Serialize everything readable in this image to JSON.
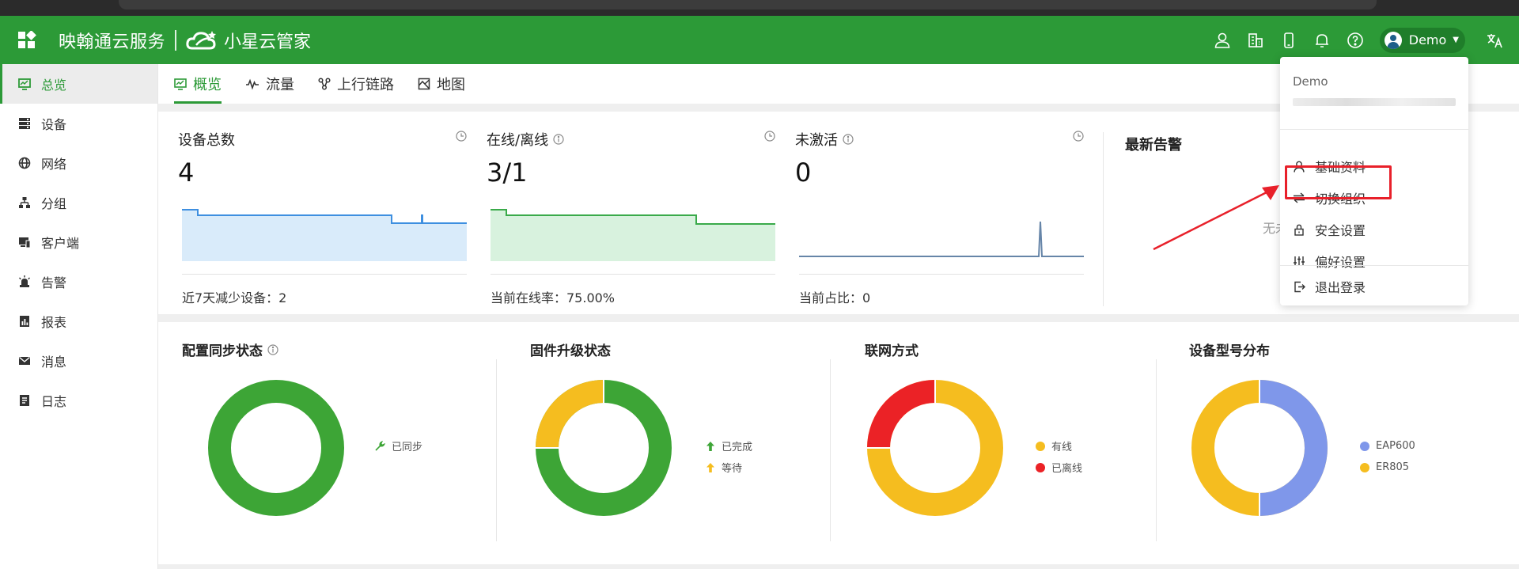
{
  "header": {
    "brand": "映翰通云服务",
    "product": "小星云管家",
    "user_name": "Demo"
  },
  "sidebar": {
    "items": [
      {
        "label": "总览",
        "icon": "monitor-icon",
        "active": true
      },
      {
        "label": "设备",
        "icon": "server-icon",
        "active": false
      },
      {
        "label": "网络",
        "icon": "globe-icon",
        "active": false
      },
      {
        "label": "分组",
        "icon": "sitemap-icon",
        "active": false
      },
      {
        "label": "客户端",
        "icon": "devices-icon",
        "active": false
      },
      {
        "label": "告警",
        "icon": "alarm-light-icon",
        "active": false
      },
      {
        "label": "报表",
        "icon": "report-icon",
        "active": false
      },
      {
        "label": "消息",
        "icon": "envelope-icon",
        "active": false
      },
      {
        "label": "日志",
        "icon": "logbook-icon",
        "active": false
      }
    ]
  },
  "tabs": [
    {
      "label": "概览",
      "icon": "monitor-icon",
      "active": true
    },
    {
      "label": "流量",
      "icon": "pulse-icon",
      "active": false
    },
    {
      "label": "上行链路",
      "icon": "link-nodes-icon",
      "active": false
    },
    {
      "label": "地图",
      "icon": "map-icon",
      "active": false
    }
  ],
  "stats": {
    "total": {
      "title": "设备总数",
      "value": "4",
      "footer": "近7天减少设备：2"
    },
    "online": {
      "title": "在线/离线",
      "value": "3/1",
      "footer": "当前在线率：75.00%"
    },
    "inactive": {
      "title": "未激活",
      "value": "0",
      "footer": "当前占比：0"
    }
  },
  "alerts": {
    "title": "最新告警",
    "empty_text": "无未"
  },
  "charts": {
    "sync": {
      "title": "配置同步状态",
      "legend": [
        "已同步"
      ]
    },
    "firmware": {
      "title": "固件升级状态",
      "legend": [
        "已完成",
        "等待"
      ]
    },
    "network": {
      "title": "联网方式",
      "legend": [
        "有线",
        "已离线"
      ]
    },
    "model": {
      "title": "设备型号分布",
      "legend": [
        "EAP600",
        "ER805"
      ]
    }
  },
  "colors": {
    "brand_green": "#2c9a37",
    "chart_green": "#3da536",
    "yellow": "#f5bd1f",
    "red": "#eb2226",
    "blue": "#7f97ea",
    "highlight": "#e8202a"
  },
  "dropdown": {
    "name": "Demo",
    "items": [
      {
        "label": "基础资料",
        "icon": "user-icon"
      },
      {
        "label": "切换组织",
        "icon": "swap-icon"
      },
      {
        "label": "安全设置",
        "icon": "lock-icon"
      },
      {
        "label": "偏好设置",
        "icon": "sliders-icon"
      },
      {
        "label": "退出登录",
        "icon": "logout-icon"
      }
    ]
  }
}
